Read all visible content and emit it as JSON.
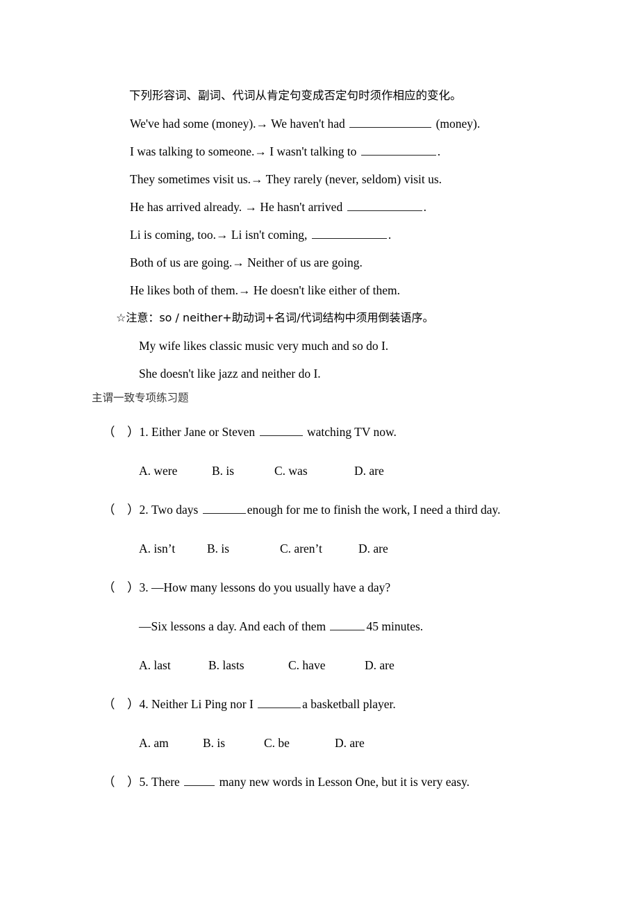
{
  "document": {
    "intro_line": "下列形容词、副词、代词从肯定句变成否定句时须作相应的变化。",
    "transformations": [
      {
        "before": "We've had some (money).→ We haven't had ",
        "after": " (money)."
      },
      {
        "before": "I was talking to someone.→ I wasn't talking to ",
        "after": "."
      },
      {
        "before": "They sometimes visit us.→ They rarely (never, seldom) visit us.",
        "after": ""
      },
      {
        "before": "He has arrived already. → He hasn't arrived ",
        "after": "."
      },
      {
        "before": "Li is coming, too.→ Li isn't coming, ",
        "after": "."
      },
      {
        "before": "Both of us are going.→ Neither of us are going.",
        "after": ""
      },
      {
        "before": "He likes both of them.→ He doesn't like either of them.",
        "after": ""
      }
    ],
    "note": "☆注意：so / neither+助动词+名词/代词结构中须用倒装语序。",
    "note_examples": [
      "My wife likes classic music very much and so do I.",
      "She doesn't like jazz and neither do I."
    ],
    "section_title": "主谓一致专项练习题",
    "bracket": "（    ）",
    "questions": [
      {
        "number": "1.",
        "text_before": " Either Jane or Steven ",
        "text_after": " watching TV now.",
        "second_line": "",
        "options": [
          "A. were",
          "B. is",
          "C. was",
          "D. are"
        ]
      },
      {
        "number": "2.",
        "text_before": " Two days ",
        "text_after": "enough for me to finish the work, I need a third day.",
        "second_line": "",
        "options": [
          "A. isn’t",
          "B. is",
          "C. aren’t",
          "D. are"
        ]
      },
      {
        "number": "3.",
        "text_before": " —How many lessons do you usually have a day?",
        "text_after": "",
        "second_line_before": "—Six lessons a day. And each of them ",
        "second_line_after": "45 minutes.",
        "options": [
          "A. last",
          "B. lasts",
          "C. have",
          "D. are"
        ]
      },
      {
        "number": "4.",
        "text_before": " Neither Li Ping nor I ",
        "text_after": "a basketball player.",
        "second_line": "",
        "options": [
          "A. am",
          "B. is",
          "C. be",
          "D. are"
        ]
      },
      {
        "number": "5.",
        "text_before": " There ",
        "text_after": " many new words in Lesson One, but it is very easy.",
        "second_line": "",
        "options": []
      }
    ]
  }
}
